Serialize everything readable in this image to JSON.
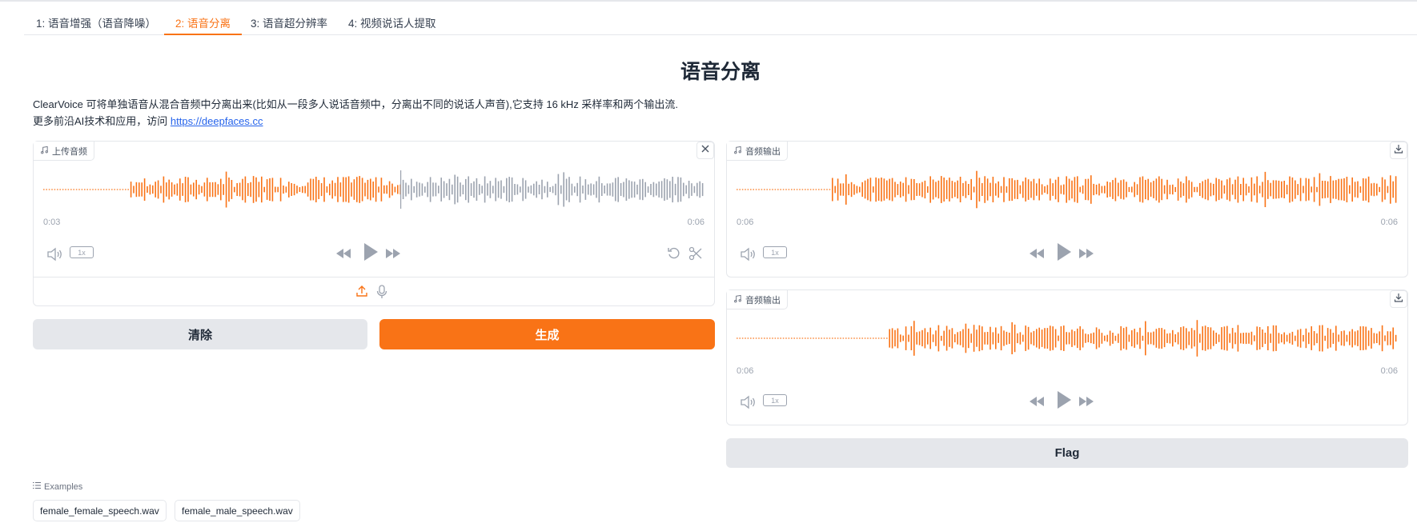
{
  "tabs": [
    {
      "label": "1: 语音增强（语音降噪）"
    },
    {
      "label": "2: 语音分离"
    },
    {
      "label": "3: 语音超分辨率"
    },
    {
      "label": "4: 视频说话人提取"
    }
  ],
  "page_title": "语音分离",
  "description": {
    "line1": "ClearVoice 可将单独语音从混合音频中分离出来(比如从一段多人说话音频中，分离出不同的说话人声音),它支持 16 kHz 采样率和两个输出流.",
    "line2_prefix": "更多前沿AI技术和应用，访问 ",
    "link": "https://deepfaces.cc"
  },
  "input_audio": {
    "label": "上传音频",
    "current_time": "0:03",
    "duration": "0:06",
    "speed": "1x",
    "progress": 0.54
  },
  "output_audio_1": {
    "label": "音频输出",
    "current_time": "0:06",
    "duration": "0:06",
    "speed": "1x"
  },
  "output_audio_2": {
    "label": "音频输出",
    "current_time": "0:06",
    "duration": "0:06",
    "speed": "1x"
  },
  "buttons": {
    "clear": "清除",
    "generate": "生成",
    "flag": "Flag"
  },
  "examples": {
    "label": "Examples",
    "items": [
      "female_female_speech.wav",
      "female_male_speech.wav"
    ]
  },
  "colors": {
    "accent": "#f97316",
    "wave_played": "#f97316",
    "wave_unplayed": "#9ca3af",
    "link": "#2563eb"
  },
  "icons": [
    "music-note-icon",
    "close-icon",
    "download-icon",
    "volume-icon",
    "rewind-icon",
    "play-icon",
    "fast-forward-icon",
    "undo-icon",
    "scissors-icon",
    "upload-icon",
    "microphone-icon",
    "list-icon"
  ]
}
